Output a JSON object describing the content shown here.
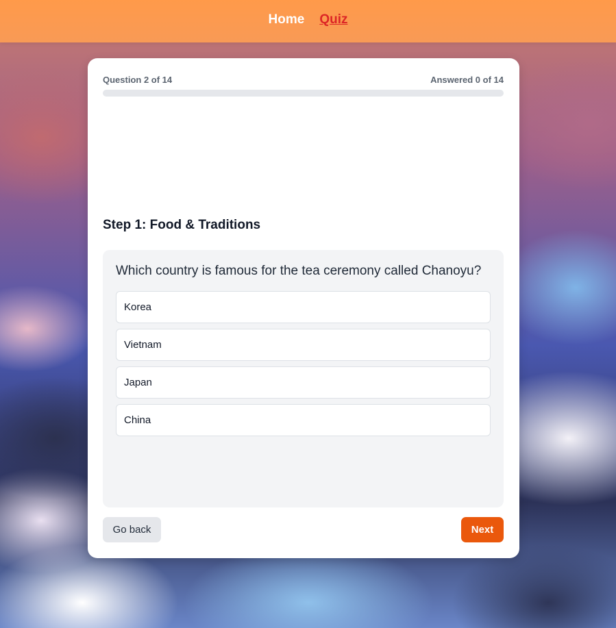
{
  "nav": {
    "items": [
      {
        "label": "Home",
        "active": false
      },
      {
        "label": "Quiz",
        "active": true
      }
    ]
  },
  "progress": {
    "question_label": "Question 2 of 14",
    "answered_label": "Answered 0 of 14",
    "answered_fraction": 0
  },
  "step": {
    "title": "Step 1: Food & Traditions"
  },
  "question": {
    "text": "Which country is famous for the tea ceremony called Chanoyu?",
    "options": [
      "Korea",
      "Vietnam",
      "Japan",
      "China"
    ]
  },
  "actions": {
    "back_label": "Go back",
    "next_label": "Next"
  },
  "colors": {
    "navbar": "#ff9a4a",
    "nav_active": "#dc2626",
    "next_button": "#ea580c",
    "progress_fill": "#f97316"
  }
}
